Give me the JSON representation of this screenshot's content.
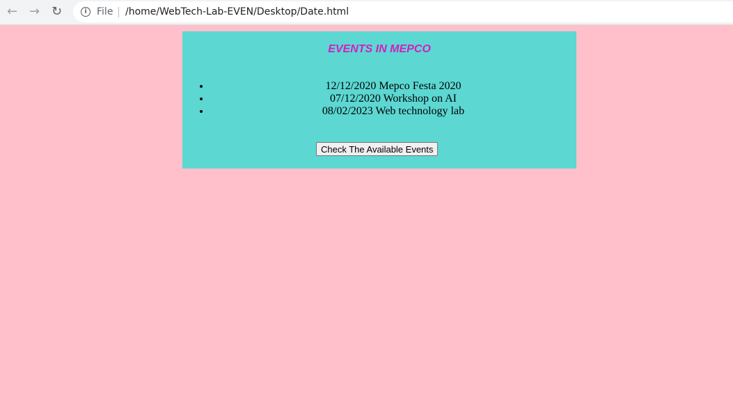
{
  "browser": {
    "scheme_label": "File",
    "url": "/home/WebTech-Lab-EVEN/Desktop/Date.html"
  },
  "page": {
    "heading": "EVENTS IN MEPCO",
    "colors": {
      "background": "#ffc0cb",
      "panel": "#5cd7d2",
      "heading": "#d21fc0"
    },
    "events": [
      "12/12/2020 Mepco Festa 2020",
      "07/12/2020 Workshop on AI",
      "08/02/2023 Web technology lab"
    ],
    "button_label": "Check The Available Events"
  }
}
